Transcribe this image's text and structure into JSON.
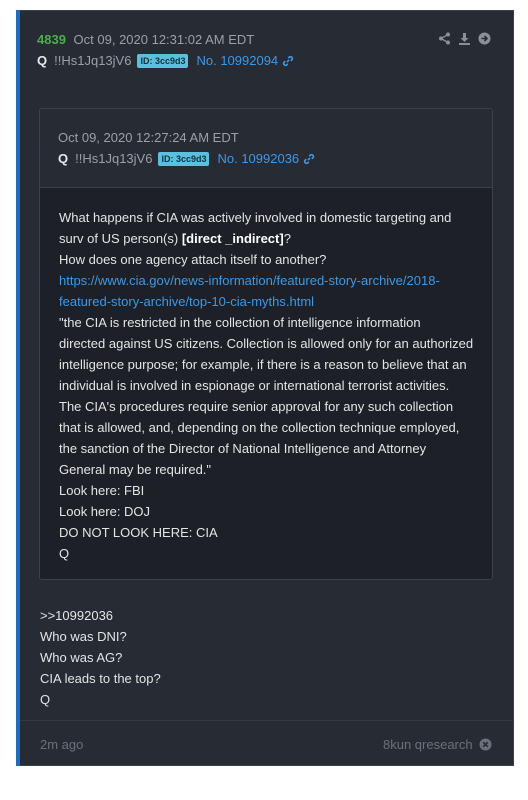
{
  "post": {
    "number": "4839",
    "timestamp": "Oct 09, 2020 12:31:02 AM EDT",
    "author": "Q",
    "tripcode": "!!Hs1Jq13jV6",
    "id_badge": "ID: 3cc9d3",
    "post_link": "No. 10992094",
    "icons": [
      "share-icon",
      "download-icon",
      "arrow-circle-right-icon"
    ]
  },
  "quoted": {
    "timestamp": "Oct 09, 2020 12:27:24 AM EDT",
    "author": "Q",
    "tripcode": "!!Hs1Jq13jV6",
    "id_badge": "ID: 3cc9d3",
    "post_link": "No. 10992036",
    "body": {
      "line1_pre": "What happens if CIA was actively involved in domestic targeting and",
      "line2_pre": "surv of US person(s) ",
      "line2_bold": "[direct _indirect]",
      "line2_post": "?",
      "line3": "How does one agency attach itself to another?",
      "link_line1": "https://www.cia.gov/news-information/featured-story-archive/2018-",
      "link_line2": "featured-story-archive/top-10-cia-myths.html",
      "quote_lines": [
        "\"the CIA is restricted in the collection of intelligence information",
        "directed against US citizens. Collection is allowed only for an authorized",
        "intelligence purpose; for example, if there is a reason to believe that an",
        "individual is involved in espionage or international terrorist activities.",
        "The CIA's procedures require senior approval for any such collection",
        "that is allowed, and, depending on the collection technique employed,",
        "the sanction of the Director of National Intelligence and Attorney",
        "General may be required.\""
      ],
      "tail_lines": [
        "Look here: FBI",
        "Look here: DOJ",
        "DO NOT LOOK HERE: CIA",
        "Q"
      ]
    }
  },
  "main_body": [
    ">>10992036",
    "Who was DNI?",
    "Who was AG?",
    "CIA leads to the top?",
    "Q"
  ],
  "footer": {
    "age": "2m ago",
    "source": "8kun qresearch"
  },
  "colors": {
    "accent_green": "#4cae4c",
    "link_blue": "#3a9ae8",
    "badge_blue": "#5bc0de",
    "card_bg": "#272b34",
    "quote_bg": "#1e2027"
  }
}
